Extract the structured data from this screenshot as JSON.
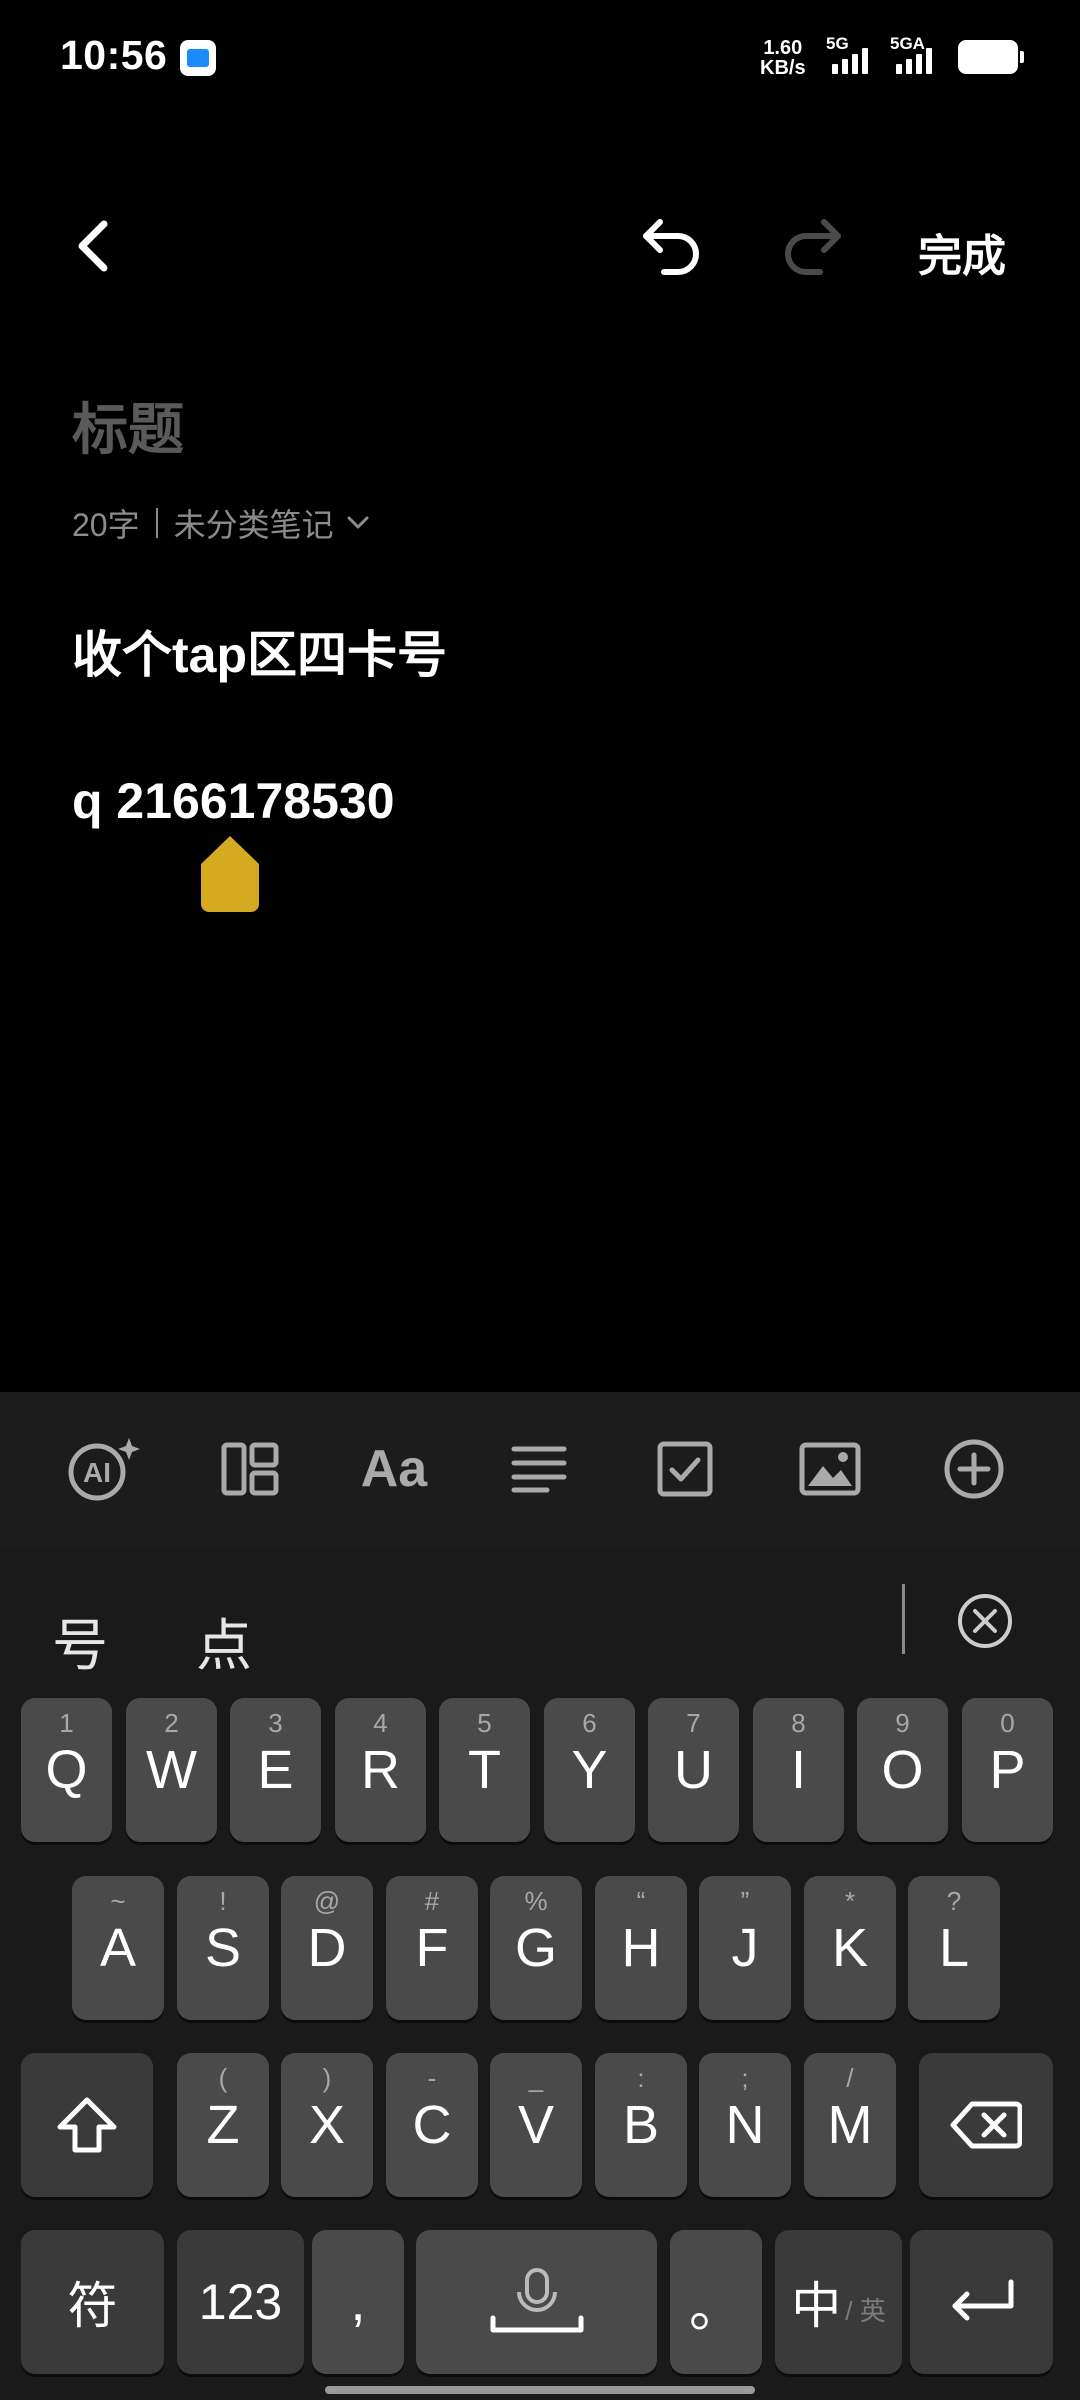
{
  "status_bar": {
    "time": "10:56",
    "net_speed_value": "1.60",
    "net_speed_unit": "KB/s",
    "sim1_label": "5G",
    "sim2_label": "5GA"
  },
  "toolbar": {
    "done_label": "完成"
  },
  "note": {
    "title_placeholder": "标题",
    "word_count": "20字",
    "category": "未分类笔记",
    "lines": [
      "收个tap区四卡号",
      "q 2166178530"
    ]
  },
  "format_toolbar": {
    "items": [
      "ai-icon",
      "layout-icon",
      "text-style-icon",
      "align-icon",
      "checkbox-icon",
      "image-icon",
      "add-icon"
    ],
    "text_style_label": "Aa",
    "ai_label": "AI"
  },
  "keyboard": {
    "candidates": [
      "号",
      "点"
    ],
    "row1": [
      {
        "key": "Q",
        "sub": "1"
      },
      {
        "key": "W",
        "sub": "2"
      },
      {
        "key": "E",
        "sub": "3"
      },
      {
        "key": "R",
        "sub": "4"
      },
      {
        "key": "T",
        "sub": "5"
      },
      {
        "key": "Y",
        "sub": "6"
      },
      {
        "key": "U",
        "sub": "7"
      },
      {
        "key": "I",
        "sub": "8"
      },
      {
        "key": "O",
        "sub": "9"
      },
      {
        "key": "P",
        "sub": "0"
      }
    ],
    "row2": [
      {
        "key": "A",
        "sub": "~"
      },
      {
        "key": "S",
        "sub": "!"
      },
      {
        "key": "D",
        "sub": "@"
      },
      {
        "key": "F",
        "sub": "#"
      },
      {
        "key": "G",
        "sub": "%"
      },
      {
        "key": "H",
        "sub": "“"
      },
      {
        "key": "J",
        "sub": "”"
      },
      {
        "key": "K",
        "sub": "*"
      },
      {
        "key": "L",
        "sub": "?"
      }
    ],
    "row3": [
      {
        "key": "Z",
        "sub": "("
      },
      {
        "key": "X",
        "sub": ")"
      },
      {
        "key": "C",
        "sub": "-"
      },
      {
        "key": "V",
        "sub": "_"
      },
      {
        "key": "B",
        "sub": ":"
      },
      {
        "key": "N",
        "sub": ";"
      },
      {
        "key": "M",
        "sub": "/"
      }
    ],
    "symbols_label": "符",
    "numbers_label": "123",
    "comma_label": ",",
    "period_label": "。",
    "lang_main": "中",
    "lang_sub": "/ 英"
  },
  "colors": {
    "accent_handle": "#D4AA20",
    "key_bg": "#4A4A4A",
    "keyboard_bg": "#1A1A1A"
  }
}
